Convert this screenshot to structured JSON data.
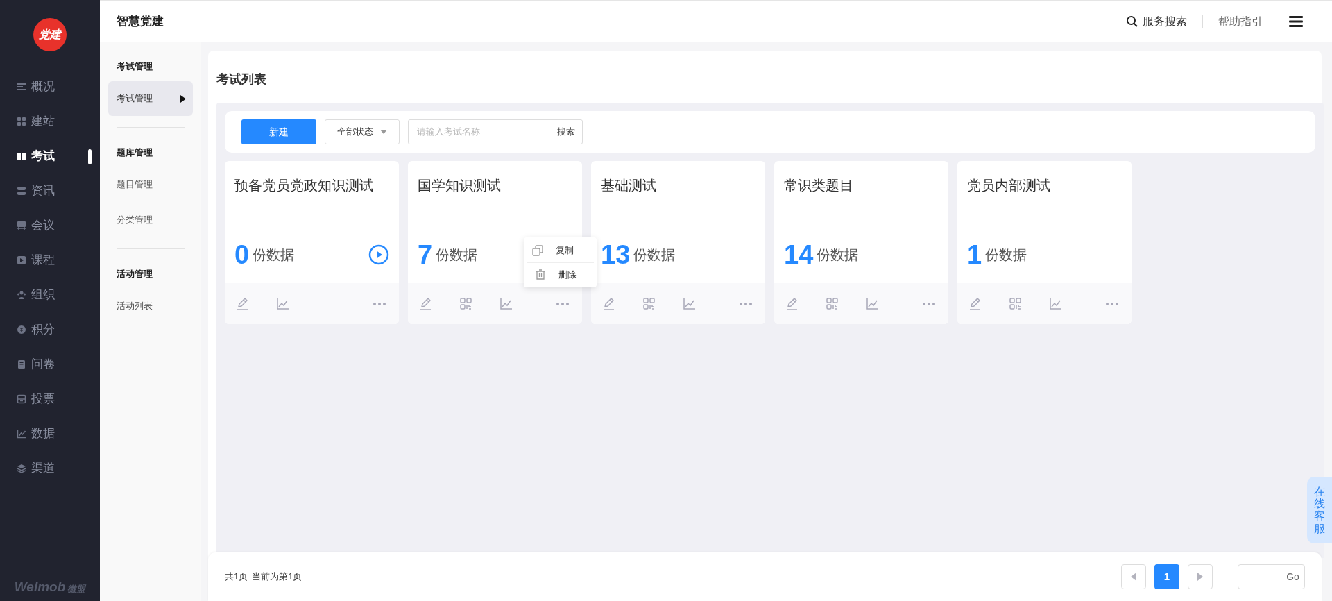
{
  "logo": {
    "text": "党建"
  },
  "nav": [
    {
      "label": "概况",
      "kind": "lines",
      "selected": false
    },
    {
      "label": "建站",
      "kind": "grid",
      "selected": false
    },
    {
      "label": "考试",
      "kind": "book",
      "selected": true
    },
    {
      "label": "资讯",
      "kind": "stack",
      "selected": false
    },
    {
      "label": "会议",
      "kind": "board",
      "selected": false
    },
    {
      "label": "课程",
      "kind": "play",
      "selected": false
    },
    {
      "label": "组织",
      "kind": "people",
      "selected": false
    },
    {
      "label": "积分",
      "kind": "coin",
      "selected": false
    },
    {
      "label": "问卷",
      "kind": "doc",
      "selected": false
    },
    {
      "label": "投票",
      "kind": "box",
      "selected": false
    },
    {
      "label": "数据",
      "kind": "chart",
      "selected": false
    },
    {
      "label": "渠道",
      "kind": "layers",
      "selected": false
    }
  ],
  "brand": {
    "text": "Weimob",
    "sub": "微盟"
  },
  "app_title": "智慧党建",
  "header": {
    "search": "服务搜索",
    "help": "帮助指引"
  },
  "subnav": [
    {
      "heading": "考试管理",
      "items": [
        {
          "label": "考试管理",
          "selected": true
        }
      ]
    },
    {
      "heading": "题库管理",
      "items": [
        {
          "label": "题目管理",
          "selected": false
        },
        {
          "label": "分类管理",
          "selected": false
        }
      ]
    },
    {
      "heading": "活动管理",
      "items": [
        {
          "label": "活动列表",
          "selected": false
        }
      ]
    }
  ],
  "page_title": "考试列表",
  "toolbar": {
    "new_button": "新建",
    "status_filter": "全部状态",
    "search_placeholder": "请输入考试名称",
    "search_button": "搜索"
  },
  "cards": [
    {
      "title": "预备党员党政知识测试",
      "count": "0",
      "unit": "份数据",
      "playable": true,
      "actions": [
        {
          "kind": "edit"
        },
        {
          "kind": "chart"
        },
        {
          "kind": "more"
        }
      ]
    },
    {
      "title": "国学知识测试",
      "count": "7",
      "unit": "份数据",
      "actions": [
        {
          "kind": "edit"
        },
        {
          "kind": "qr"
        },
        {
          "kind": "chart"
        },
        {
          "kind": "more"
        }
      ],
      "menu": [
        {
          "kind": "copy",
          "label": "复制"
        },
        {
          "kind": "trash",
          "label": "删除"
        }
      ]
    },
    {
      "title": "基础测试",
      "count": "13",
      "unit": "份数据",
      "playable": false,
      "actions": [
        {
          "kind": "edit"
        },
        {
          "kind": "qr"
        },
        {
          "kind": "chart"
        },
        {
          "kind": "more"
        }
      ]
    },
    {
      "title": "常识类题目",
      "count": "14",
      "unit": "份数据",
      "playable": false,
      "actions": [
        {
          "kind": "edit"
        },
        {
          "kind": "qr"
        },
        {
          "kind": "chart"
        },
        {
          "kind": "more"
        }
      ]
    },
    {
      "title": "党员内部测试",
      "count": "1",
      "unit": "份数据",
      "playable": false,
      "actions": [
        {
          "kind": "edit"
        },
        {
          "kind": "qr"
        },
        {
          "kind": "chart"
        },
        {
          "kind": "more"
        }
      ]
    }
  ],
  "pagination": {
    "total": "共1页",
    "current": "当前为第1页",
    "pages": [
      {
        "label": "1",
        "selected": true
      }
    ],
    "go": "Go"
  },
  "service_tab": "在线客服"
}
